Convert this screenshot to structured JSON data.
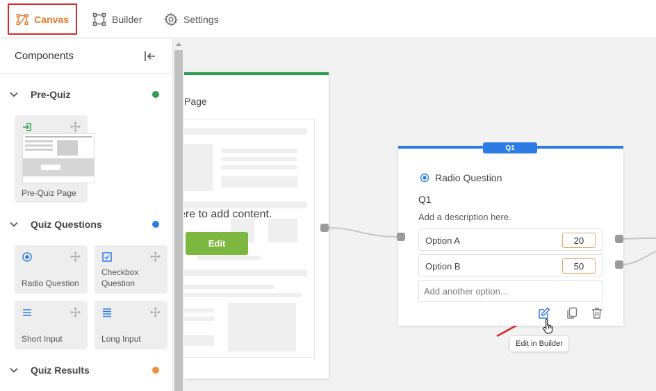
{
  "tabs": [
    {
      "label": "Canvas",
      "icon": "canvas-icon",
      "active": true
    },
    {
      "label": "Builder",
      "icon": "builder-icon",
      "active": false
    },
    {
      "label": "Settings",
      "icon": "gear-icon",
      "active": false
    }
  ],
  "sidebar": {
    "title": "Components",
    "sections": [
      {
        "label": "Pre-Quiz",
        "dot_color": "#2e9e4f"
      },
      {
        "label": "Quiz Questions",
        "dot_color": "#2d7be5"
      },
      {
        "label": "Quiz Results",
        "dot_color": "#f0903a"
      }
    ],
    "components": {
      "pre_quiz_page": "Pre-Quiz Page",
      "radio_question": "Radio Question",
      "checkbox_question": "Checkbox Question",
      "short_input": "Short Input",
      "long_input": "Long Input"
    }
  },
  "canvas": {
    "page_node": {
      "title": "Page",
      "placeholder": "ere to add content.",
      "edit_label": "Edit"
    },
    "question_node": {
      "badge": "Q1",
      "type_label": "Radio Question",
      "title": "Q1",
      "description": "Add a description here.",
      "options": [
        {
          "label": "Option A",
          "score": "20"
        },
        {
          "label": "Option B",
          "score": "50"
        }
      ],
      "add_option_placeholder": "Add another option...",
      "tooltip": "Edit in Builder"
    }
  },
  "colors": {
    "accent": "#e8782a",
    "highlight": "#d62a2a",
    "pre_quiz": "#2e9e4f",
    "questions": "#2d7be5",
    "results": "#f0903a",
    "edit_button": "#7cb73f"
  }
}
